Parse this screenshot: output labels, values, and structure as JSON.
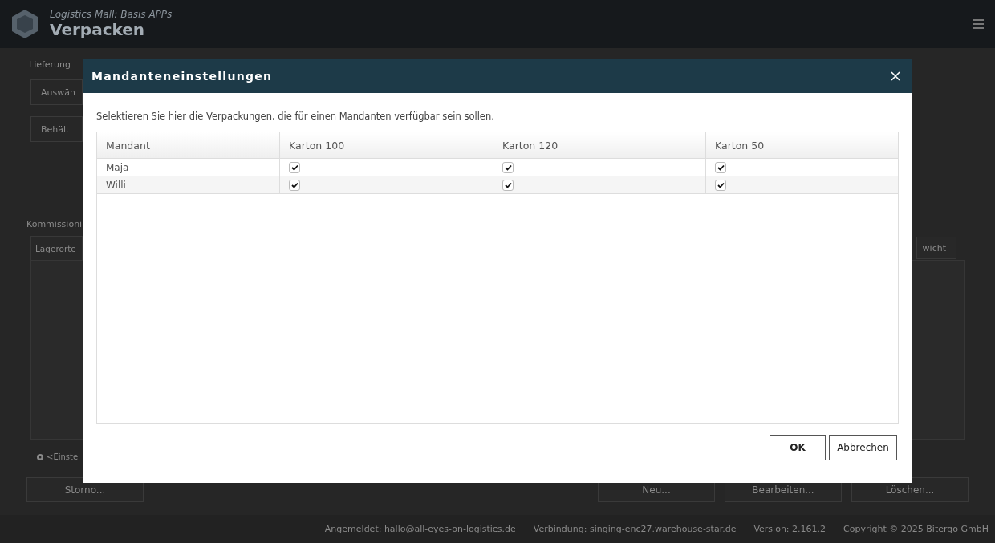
{
  "app": {
    "subtitle": "Logistics Mall: Basis APPs",
    "title": "Verpacken"
  },
  "page": {
    "section_1": "Lieferung",
    "buttons_1": [
      "Auswäh",
      "Behält"
    ],
    "section_2": "Kommissioni",
    "tab": "Lagerorte",
    "side_button": "wicht",
    "settings_link": "<Einste",
    "left_button": "Storno...",
    "right_buttons": [
      "Neu...",
      "Bearbeiten...",
      "Löschen..."
    ]
  },
  "status_bar": [
    "Angemeldet: hallo@all-eyes-on-logistics.de",
    "Verbindung: singing-enc27.warehouse-star.de",
    "Version: 2.161.2",
    "Copyright © 2025 Bitergo GmbH"
  ],
  "dialog": {
    "title": "Mandanteneinstellungen",
    "description": "Selektieren Sie hier die Verpackungen, die für einen Mandanten verfügbar sein sollen.",
    "table": {
      "columns": [
        "Mandant",
        "Karton 100",
        "Karton 120",
        "Karton 50"
      ],
      "rows": [
        {
          "name": "Maja",
          "checks": [
            true,
            true,
            true
          ]
        },
        {
          "name": "Willi",
          "checks": [
            true,
            true,
            true
          ]
        }
      ]
    },
    "buttons": [
      {
        "label": "OK",
        "kind": "primary"
      },
      {
        "label": "Abbrechen",
        "kind": "secondary"
      }
    ]
  }
}
